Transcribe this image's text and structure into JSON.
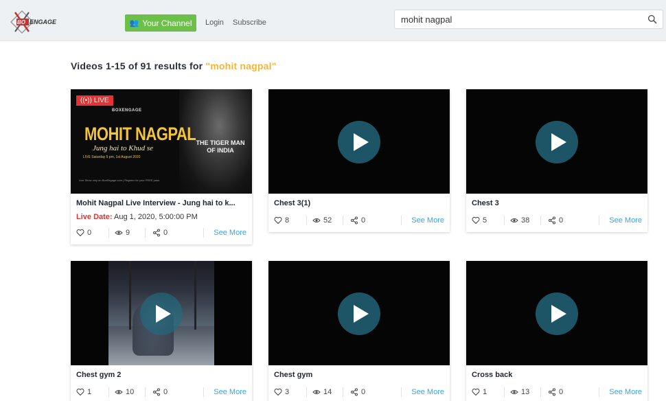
{
  "header": {
    "logo_alt": "BOXENGAGE",
    "channel_button": "Your Channel",
    "login": "Login",
    "subscribe": "Subscribe",
    "search_value": "mohit nagpal",
    "brand_green": "#6cc04a"
  },
  "results": {
    "prefix": "Videos 1-15 of 91 results for ",
    "query": "\"mohit nagpal\""
  },
  "cards": [
    {
      "title": "Mohit Nagpal Live Interview - Jung hai to k...",
      "live_label": "Live Date:",
      "live_date": "Aug 1, 2020, 5:00:00 PM",
      "likes": "0",
      "views": "9",
      "shares": "0",
      "see_more": "See More",
      "badge": "LIVE",
      "poster": {
        "brand": "BOXENGAGE",
        "title": "MOHIT NAGPAL",
        "tagline": "Jung hai to Khud se",
        "when": "LIVE Saturday 5 pm, 1st August 2020",
        "tiger": "THE TIGER MAN OF INDIA",
        "foot": "Live Show only on BoxEngage.com | Register for your FREE pass"
      }
    },
    {
      "title": "Chest 3(1)",
      "likes": "8",
      "views": "52",
      "shares": "0",
      "see_more": "See More"
    },
    {
      "title": "Chest 3",
      "likes": "5",
      "views": "38",
      "shares": "0",
      "see_more": "See More"
    },
    {
      "title": "Chest gym 2",
      "likes": "1",
      "views": "10",
      "shares": "0",
      "see_more": "See More"
    },
    {
      "title": "Chest gym",
      "likes": "3",
      "views": "14",
      "shares": "0",
      "see_more": "See More"
    },
    {
      "title": "Cross back",
      "likes": "1",
      "views": "13",
      "shares": "0",
      "see_more": "See More"
    }
  ]
}
